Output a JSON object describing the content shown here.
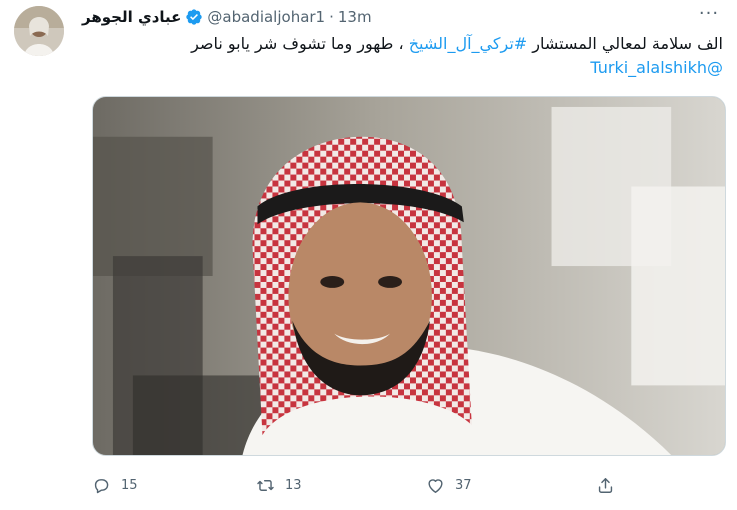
{
  "tweet": {
    "author": {
      "display_name": "عبادي الجوهر",
      "handle": "@abadialjohar1",
      "verified": true,
      "avatar_icon": "avatar-photo"
    },
    "separator": "·",
    "time": "13m",
    "more_icon": "more-icon",
    "more_label": "···",
    "text": {
      "part1": "الف سلامة لمعالي المستشار ",
      "hashtag": "#تركي_آل_الشيخ",
      "part2": " ، طهور وما تشوف شر يابو ناصر",
      "mention": "@Turki_alalshikh"
    },
    "link_color": "#1d9bf0",
    "media": {
      "type": "photo",
      "alt_icon": "photo-man-in-shemagh"
    },
    "actions": {
      "reply": {
        "icon": "reply-icon",
        "count": "15"
      },
      "retweet": {
        "icon": "retweet-icon",
        "count": "13"
      },
      "like": {
        "icon": "heart-icon",
        "count": "37"
      },
      "share": {
        "icon": "share-icon"
      }
    }
  }
}
